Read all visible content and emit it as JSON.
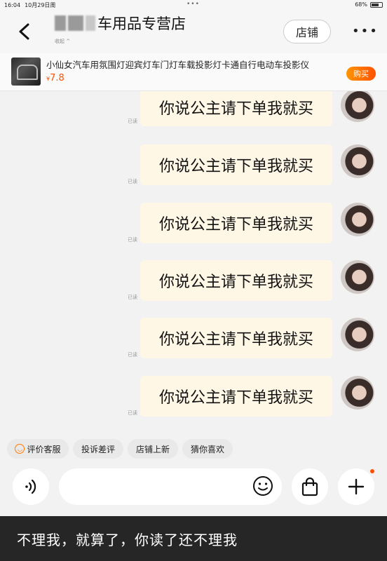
{
  "status_bar": {
    "time": "16:04",
    "date": "10月29日周",
    "battery": "68%"
  },
  "header": {
    "shop_name": "车用品专营店",
    "collapse_label": "收起 ^",
    "store_button": "店铺"
  },
  "product": {
    "name": "小仙女汽车用氛围灯迎宾灯车门灯车载投影灯卡通自行电动车投影仪",
    "currency": "¥",
    "price": "7.8",
    "buy_button": "购买"
  },
  "messages": [
    {
      "text": "你说公主请下单我就买",
      "read": "已读"
    },
    {
      "text": "你说公主请下单我就买",
      "read": "已读"
    },
    {
      "text": "你说公主请下单我就买",
      "read": "已读"
    },
    {
      "text": "你说公主请下单我就买",
      "read": "已读"
    },
    {
      "text": "你说公主请下单我就买",
      "read": "已读"
    },
    {
      "text": "你说公主请下单我就买",
      "read": "已读"
    }
  ],
  "quick_actions": [
    "评价客服",
    "投诉差评",
    "店铺上新",
    "猜你喜欢"
  ],
  "input": {
    "placeholder": ""
  },
  "caption": "不理我，就算了，你读了还不理我",
  "colors": {
    "accent": "#ff5000",
    "bubble": "#fff7e6",
    "caption_bg": "#262626"
  },
  "icons": [
    "back-icon",
    "more-icon",
    "voice-icon",
    "emoji-icon",
    "shopping-bag-icon",
    "plus-icon",
    "smile-icon"
  ]
}
